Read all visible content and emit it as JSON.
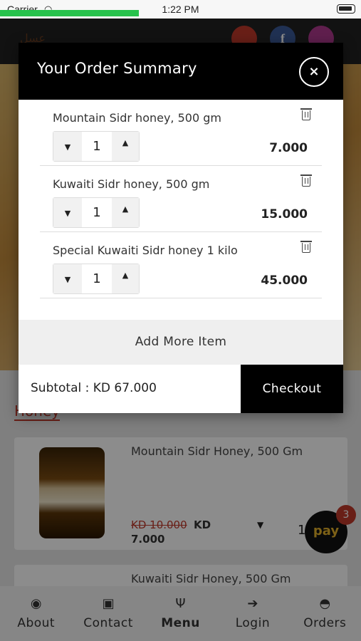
{
  "status_bar": {
    "carrier": "Carrier",
    "wifi_icon": "wifi-icon",
    "time": "1:22 PM",
    "battery_icon": "battery-icon"
  },
  "colors": {
    "accent": "#c0392b",
    "header": "#000000",
    "progress": "#27c24c",
    "pay_yellow": "#e3b12b"
  },
  "modal": {
    "title": "Your Order Summary",
    "close_label": "×",
    "items": [
      {
        "name": "Mountain Sidr honey, 500 gm",
        "qty": "1",
        "price": "7.000"
      },
      {
        "name": "Kuwaiti Sidr honey, 500 gm",
        "qty": "1",
        "price": "15.000"
      },
      {
        "name": "Special Kuwaiti Sidr honey 1 kilo",
        "qty": "1",
        "price": "45.000"
      }
    ],
    "add_more": "Add More Item",
    "subtotal": "Subtotal : KD 67.000",
    "checkout": "Checkout"
  },
  "background": {
    "section_heading": "Honey",
    "products": [
      {
        "name": "Mountain Sidr Honey, 500 Gm",
        "old_price": "KD 10.000",
        "currency": "KD",
        "new_price": "7.000",
        "qty": "1"
      },
      {
        "name": "Kuwaiti Sidr Honey, 500 Gm"
      }
    ],
    "pay_label": "pay",
    "cart_count": "3"
  },
  "bottom_nav": [
    {
      "label": "About",
      "icon": "user-circle-icon"
    },
    {
      "label": "Contact",
      "icon": "contact-card-icon"
    },
    {
      "label": "Menu",
      "icon": "fork-knife-icon"
    },
    {
      "label": "Login",
      "icon": "login-icon"
    },
    {
      "label": "Orders",
      "icon": "basket-icon"
    }
  ]
}
